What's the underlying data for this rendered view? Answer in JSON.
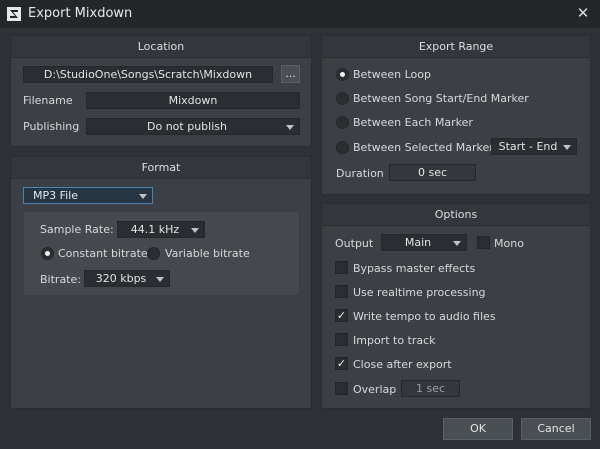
{
  "window": {
    "title": "Export Mixdown",
    "close_glyph": "✕",
    "icon": "studio-one-logo-icon"
  },
  "location": {
    "header": "Location",
    "path": "D:\\StudioOne\\Songs\\Scratch\\Mixdown",
    "browse_label": "...",
    "filename_label": "Filename",
    "filename_value": "Mixdown",
    "publishing_label": "Publishing",
    "publishing_value": "Do not publish"
  },
  "format": {
    "header": "Format",
    "file_type": "MP3 File",
    "sample_rate_label": "Sample Rate:",
    "sample_rate_value": "44.1 kHz",
    "constant_bitrate_label": "Constant bitrate",
    "variable_bitrate_label": "Variable bitrate",
    "bitrate_label": "Bitrate:",
    "bitrate_value": "320 kbps"
  },
  "export_range": {
    "header": "Export Range",
    "options": [
      {
        "label": "Between Loop",
        "selected": true
      },
      {
        "label": "Between Song Start/End Marker",
        "selected": false
      },
      {
        "label": "Between Each Marker",
        "selected": false
      },
      {
        "label": "Between Selected Markers",
        "selected": false
      }
    ],
    "marker_select": "Start - End",
    "duration_label": "Duration",
    "duration_value": "0 sec"
  },
  "options": {
    "header": "Options",
    "output_label": "Output",
    "output_value": "Main",
    "mono_label": "Mono",
    "checks": [
      {
        "label": "Bypass master effects",
        "checked": false
      },
      {
        "label": "Use realtime processing",
        "checked": false
      },
      {
        "label": "Write tempo to audio files",
        "checked": true
      },
      {
        "label": "Import to track",
        "checked": false
      },
      {
        "label": "Close after export",
        "checked": true
      },
      {
        "label": "Overlap",
        "checked": false
      }
    ],
    "overlap_value": "1 sec"
  },
  "buttons": {
    "ok": "OK",
    "cancel": "Cancel"
  },
  "glyphs": {
    "check": "✓"
  }
}
